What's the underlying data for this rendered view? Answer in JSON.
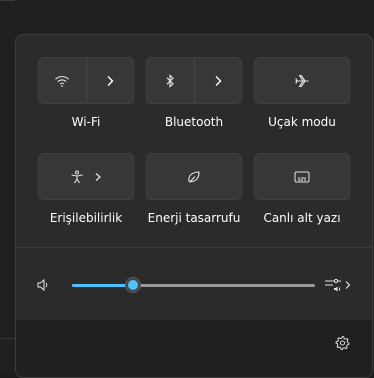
{
  "quick_settings": {
    "tiles": [
      {
        "id": "wifi",
        "label": "Wi-Fi",
        "icon": "wifi-icon"
      },
      {
        "id": "bluetooth",
        "label": "Bluetooth",
        "icon": "bluetooth-icon"
      },
      {
        "id": "airplane",
        "label": "Uçak modu",
        "icon": "airplane-icon"
      },
      {
        "id": "accessibility",
        "label": "Erişilebilirlik",
        "icon": "accessibility-icon"
      },
      {
        "id": "energy_saver",
        "label": "Enerji tasarrufu",
        "icon": "leaf-icon"
      },
      {
        "id": "live_captions",
        "label": "Canlı alt yazı",
        "icon": "captions-icon"
      }
    ]
  },
  "volume": {
    "level_percent": 25,
    "icon": "speaker-icon",
    "output_icon": "audio-output-icon"
  },
  "footer": {
    "icon": "gear-icon"
  },
  "colors": {
    "accent": "#4cc2ff",
    "panel_bg": "#2b2b2b",
    "tile_bg": "#373737",
    "footer_bg": "#202020"
  }
}
